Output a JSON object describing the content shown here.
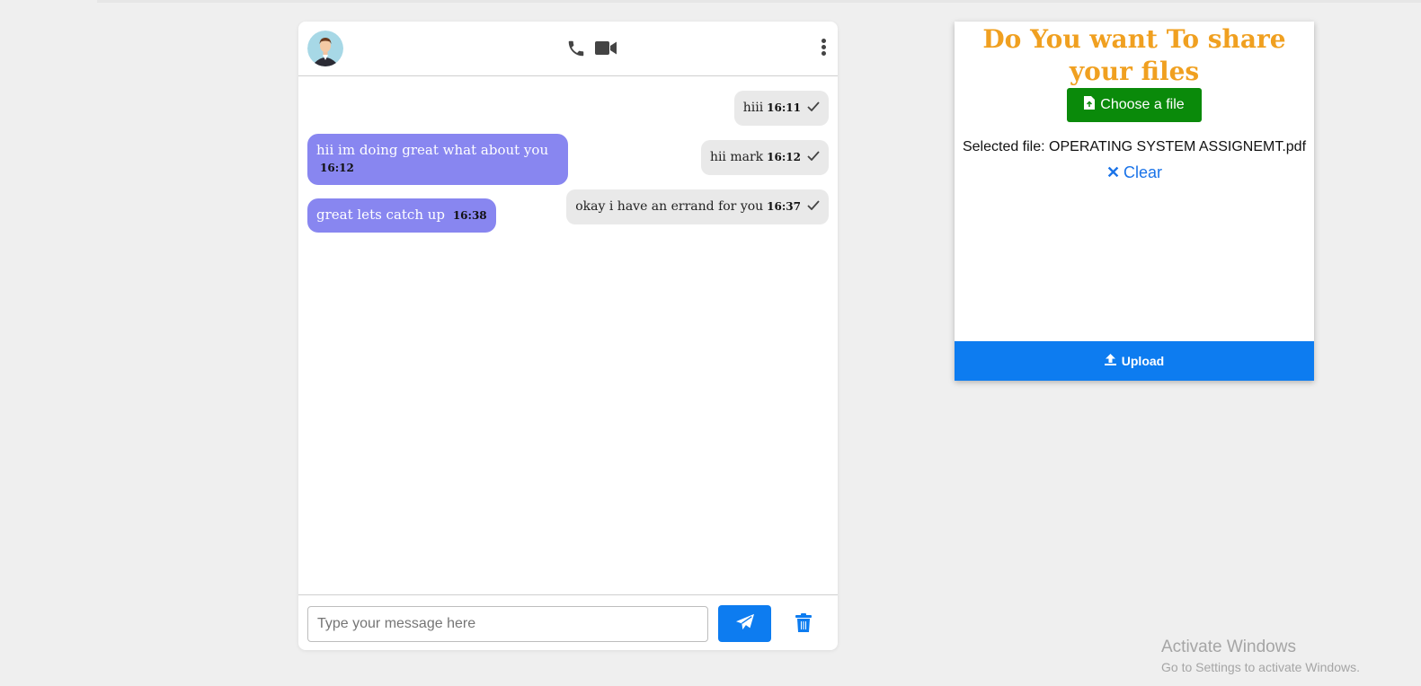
{
  "chat": {
    "header": {
      "avatar": "user-avatar",
      "icons": [
        "phone-icon",
        "video-icon",
        "more-vertical-icon"
      ]
    },
    "sent_messages": [
      {
        "text": "hiii",
        "time": "16:11"
      },
      {
        "text": "hii mark",
        "time": "16:12"
      },
      {
        "text": "okay i have an errand for you",
        "time": "16:37"
      }
    ],
    "received_messages": [
      {
        "text": "hii im doing great what about you",
        "time": "16:12"
      },
      {
        "text": "great lets catch up",
        "time": "16:38"
      }
    ],
    "footer": {
      "input_placeholder": "Type your message here",
      "input_value": "",
      "send_icon": "send-icon",
      "delete_icon": "trash-icon"
    }
  },
  "upload": {
    "title": "Do You want To share your files",
    "choose_label": "Choose a file",
    "selected_file": "Selected file: OPERATING SYSTEM ASSIGNEMT.pdf",
    "clear_label": "Clear",
    "upload_label": "Upload"
  },
  "watermark": {
    "line1": "Activate Windows",
    "line2": "Go to Settings to activate Windows."
  },
  "colors": {
    "received_bubble": "#8886f0",
    "sent_bubble": "#e9e9e9",
    "accent_blue": "#0d7cf0",
    "choose_green": "#0a8a0a",
    "title_orange": "#f0a020"
  }
}
